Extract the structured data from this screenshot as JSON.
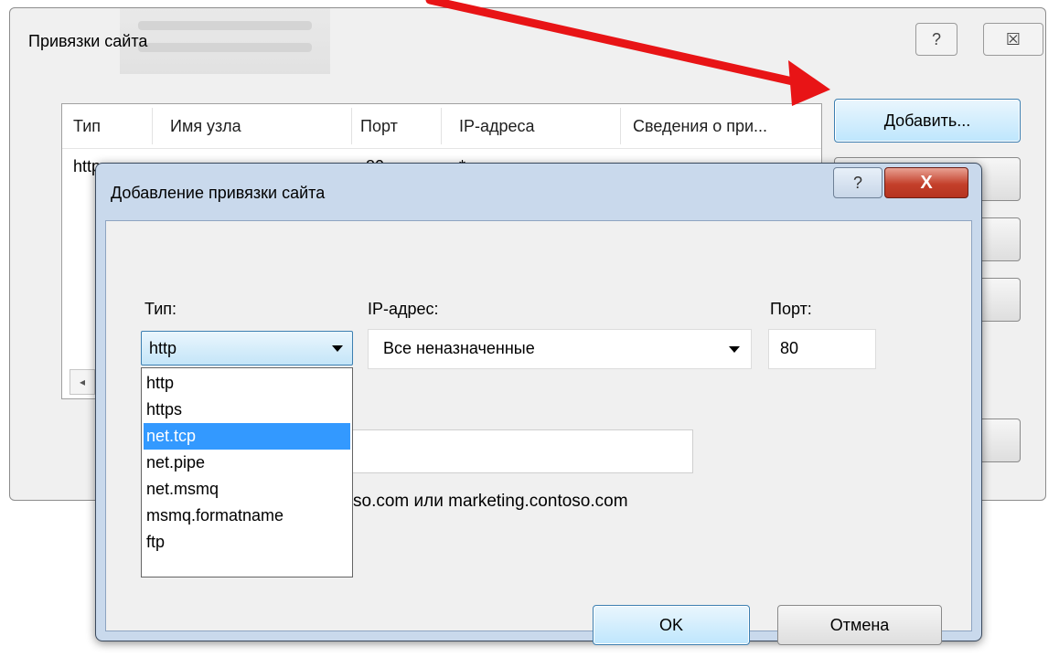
{
  "outer_dialog": {
    "title": "Привязки сайта",
    "help_glyph": "?",
    "close_glyph": "☒",
    "columns": [
      "Тип",
      "Имя узла",
      "Порт",
      "IP-адреса",
      "Сведения о при..."
    ],
    "row": {
      "type": "http",
      "host": "",
      "port": "80",
      "ip": "*"
    },
    "add_button": "Добавить...",
    "scroll_left_glyph": "◂"
  },
  "front_dialog": {
    "title": "Добавление привязки сайта",
    "help_glyph": "?",
    "close_glyph": "X",
    "type_label": "Тип:",
    "type_value": "http",
    "ip_label": "IP-адрес:",
    "ip_value": "Все неназначенные",
    "port_label": "Порт:",
    "port_value": "80",
    "host_example": "so.com или marketing.contoso.com",
    "dropdown_options": [
      "http",
      "https",
      "net.tcp",
      "net.pipe",
      "net.msmq",
      "msmq.formatname",
      "ftp"
    ],
    "selected_option": "net.tcp",
    "ok_button": "OK",
    "cancel_button": "Отмена"
  },
  "colors": {
    "arrow": "#e81416",
    "selection": "#3399ff",
    "close_button": "#c4402b"
  }
}
